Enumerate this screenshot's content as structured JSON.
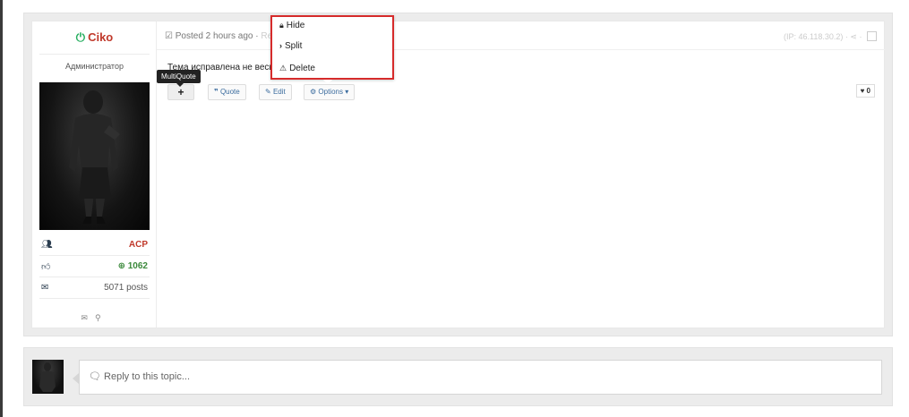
{
  "post": {
    "author": {
      "name": "Ciko",
      "role": "Администратор",
      "stats": [
        {
          "icon": "group-icon",
          "value": "ACP",
          "color": "#c0392b"
        },
        {
          "icon": "thumbs-up-icon",
          "value": "1062",
          "color": "#3c8a3c"
        },
        {
          "icon": "envelope-icon",
          "value": "5071 posts",
          "color": "#555555"
        }
      ]
    },
    "meta": {
      "posted": "Posted 2 hours ago",
      "separator": "·",
      "report": "Report",
      "ip": "(IP: 46.118.30.2)",
      "share_sep": "·"
    },
    "content": "Тема исправлена не весь",
    "buttons": {
      "multiquote": "+",
      "quote": "Quote",
      "edit": "Edit",
      "options": "Options"
    },
    "likes": "0",
    "tooltip": "MultiQuote"
  },
  "options_menu": {
    "items": [
      {
        "label": "Hide",
        "icon": "lock-icon"
      },
      {
        "label": "Split",
        "icon": "chevron-right-icon"
      },
      {
        "label": "Delete",
        "icon": "warning-icon"
      }
    ]
  },
  "reply": {
    "placeholder": "Reply to this topic..."
  },
  "colors": {
    "highlight_border": "#d62b2b",
    "username": "#c0392b",
    "power_icon": "#27ae60",
    "link": "#3b6c9e"
  }
}
